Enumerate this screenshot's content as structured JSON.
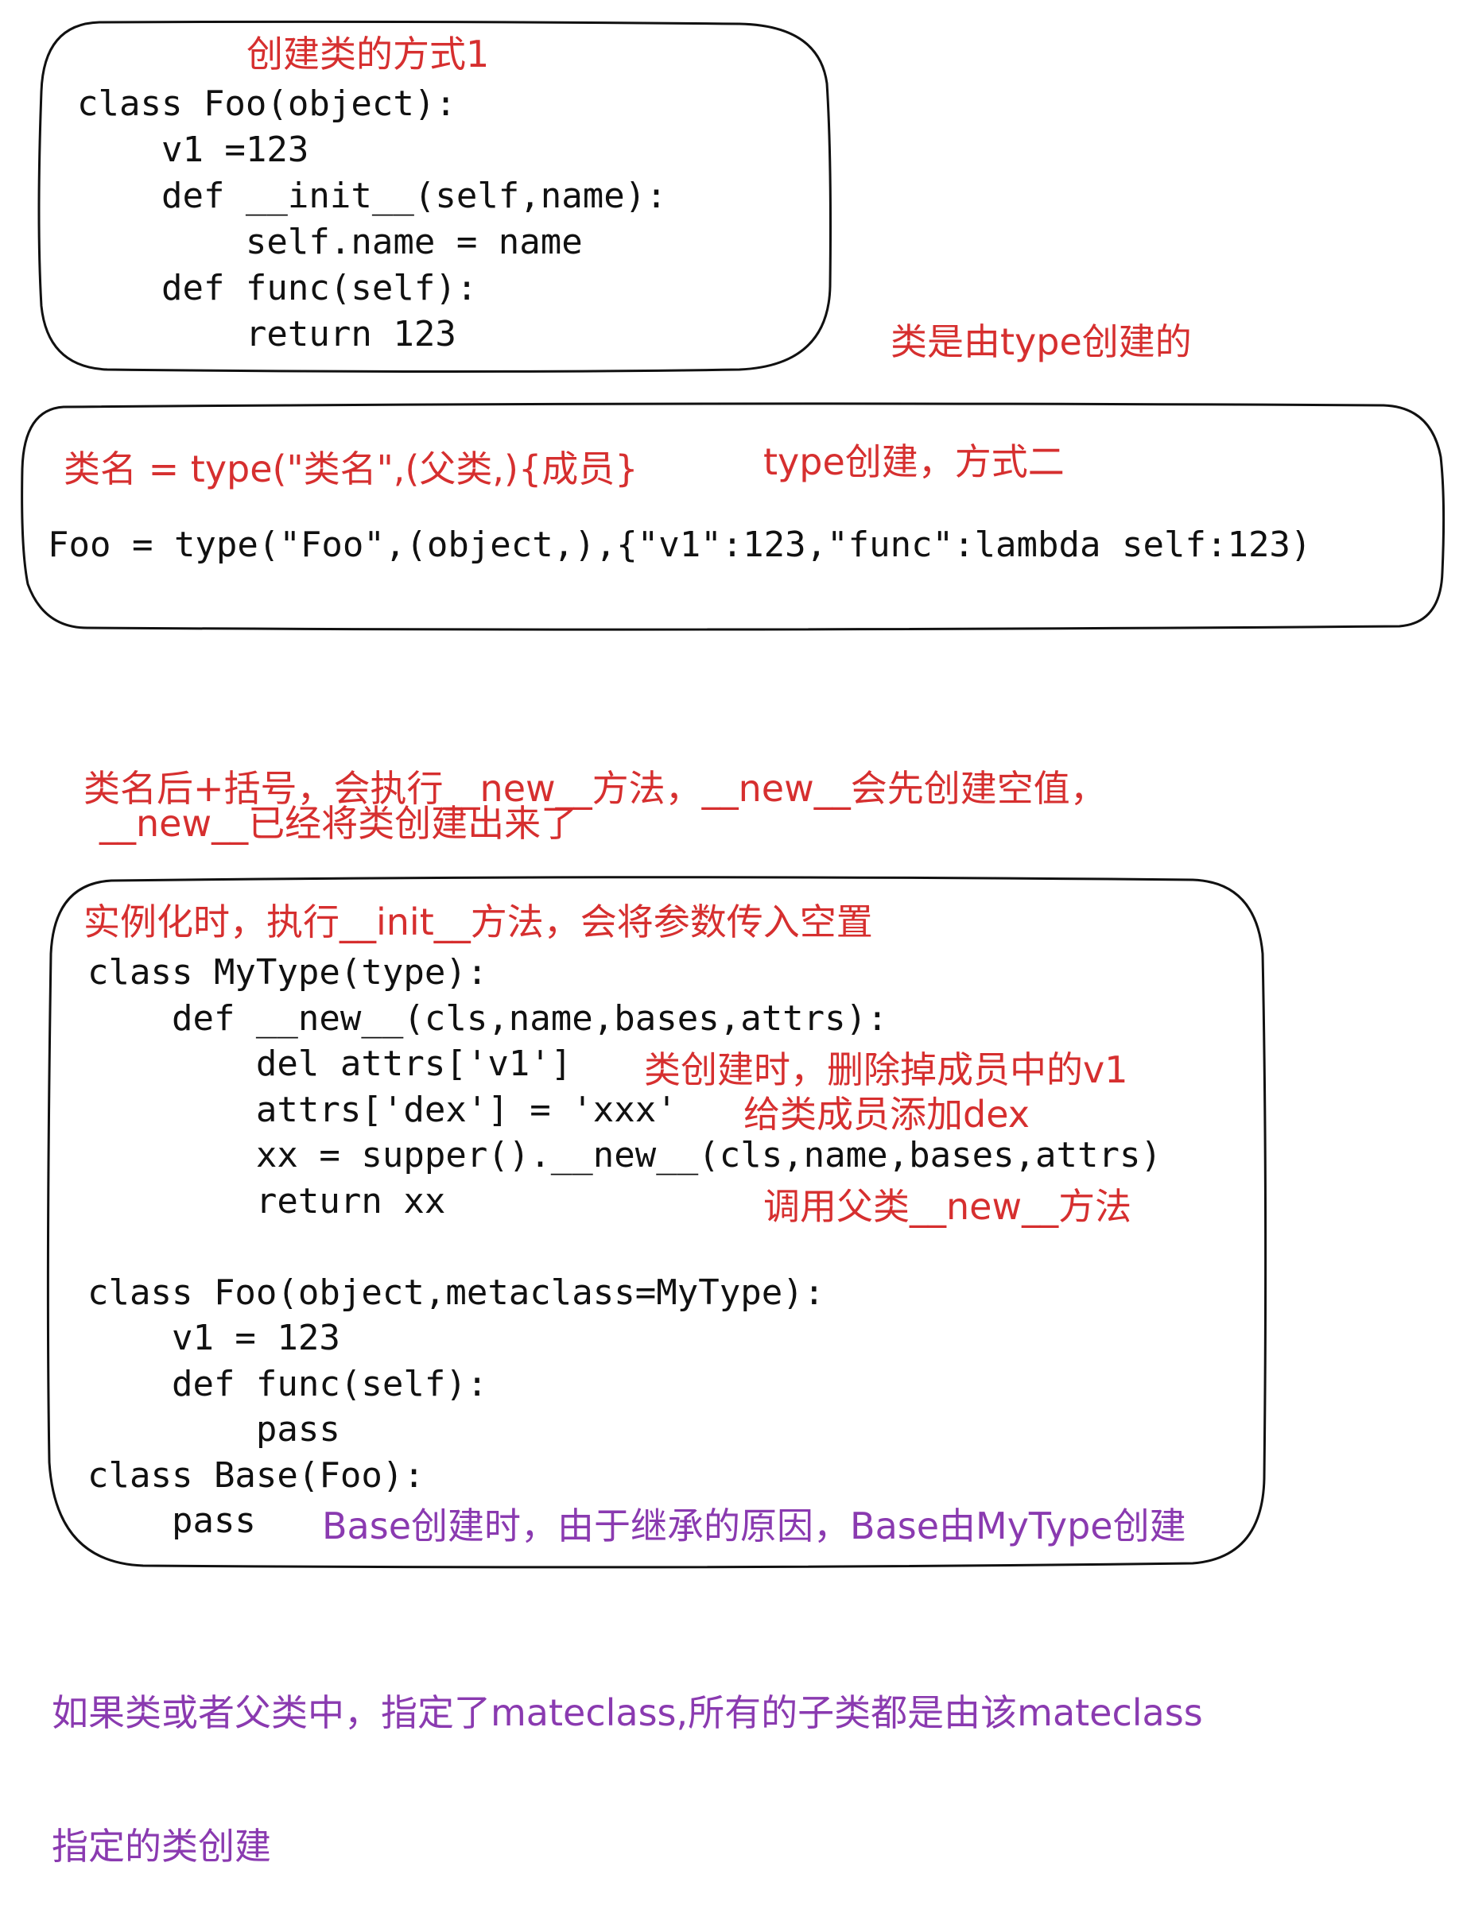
{
  "colors": {
    "annotation_red": "#d62f2f",
    "annotation_purple": "#8a3ab0",
    "code": "#111111",
    "border": "#111111"
  },
  "box1": {
    "title": "创建类的方式1",
    "code": [
      "class Foo(object):",
      "    v1 =123",
      "    def __init__(self,name):",
      "        self.name = name",
      "    def func(self):",
      "        return 123"
    ]
  },
  "note_type": "类是由type创建的",
  "box2": {
    "syntax": "类名 = type(\"类名\",(父类,){成员}",
    "label": "type创建，方式二",
    "example": "Foo = type(\"Foo\",(object,),{\"v1\":123,\"func\":lambda self:123)"
  },
  "explain": {
    "line1": "类名后+括号，会执行__new__方法，__new__会先创建空值，",
    "line2": "实例化时，执行__init__方法，会将参数传入空置",
    "line3": "__new__已经将类创建出来了"
  },
  "box3": {
    "code": [
      "class MyType(type):",
      "    def __new__(cls,name,bases,attrs):",
      "        del attrs['v1']",
      "        attrs['dex'] = 'xxx'",
      "        xx = supper().__new__(cls,name,bases,attrs)",
      "        return xx",
      "",
      "class Foo(object,metaclass=MyType):",
      "    v1 = 123",
      "    def func(self):",
      "        pass",
      "class Base(Foo):",
      "    pass"
    ],
    "ann_del": "类创建时，删除掉成员中的v1",
    "ann_dex": "给类成员添加dex",
    "ann_super": "调用父类__new__方法",
    "ann_base": "Base创建时，由于继承的原因，Base由MyType创建"
  },
  "footer": {
    "line1": "如果类或者父类中，指定了mateclass,所有的子类都是由该mateclass",
    "line2": "指定的类创建"
  }
}
